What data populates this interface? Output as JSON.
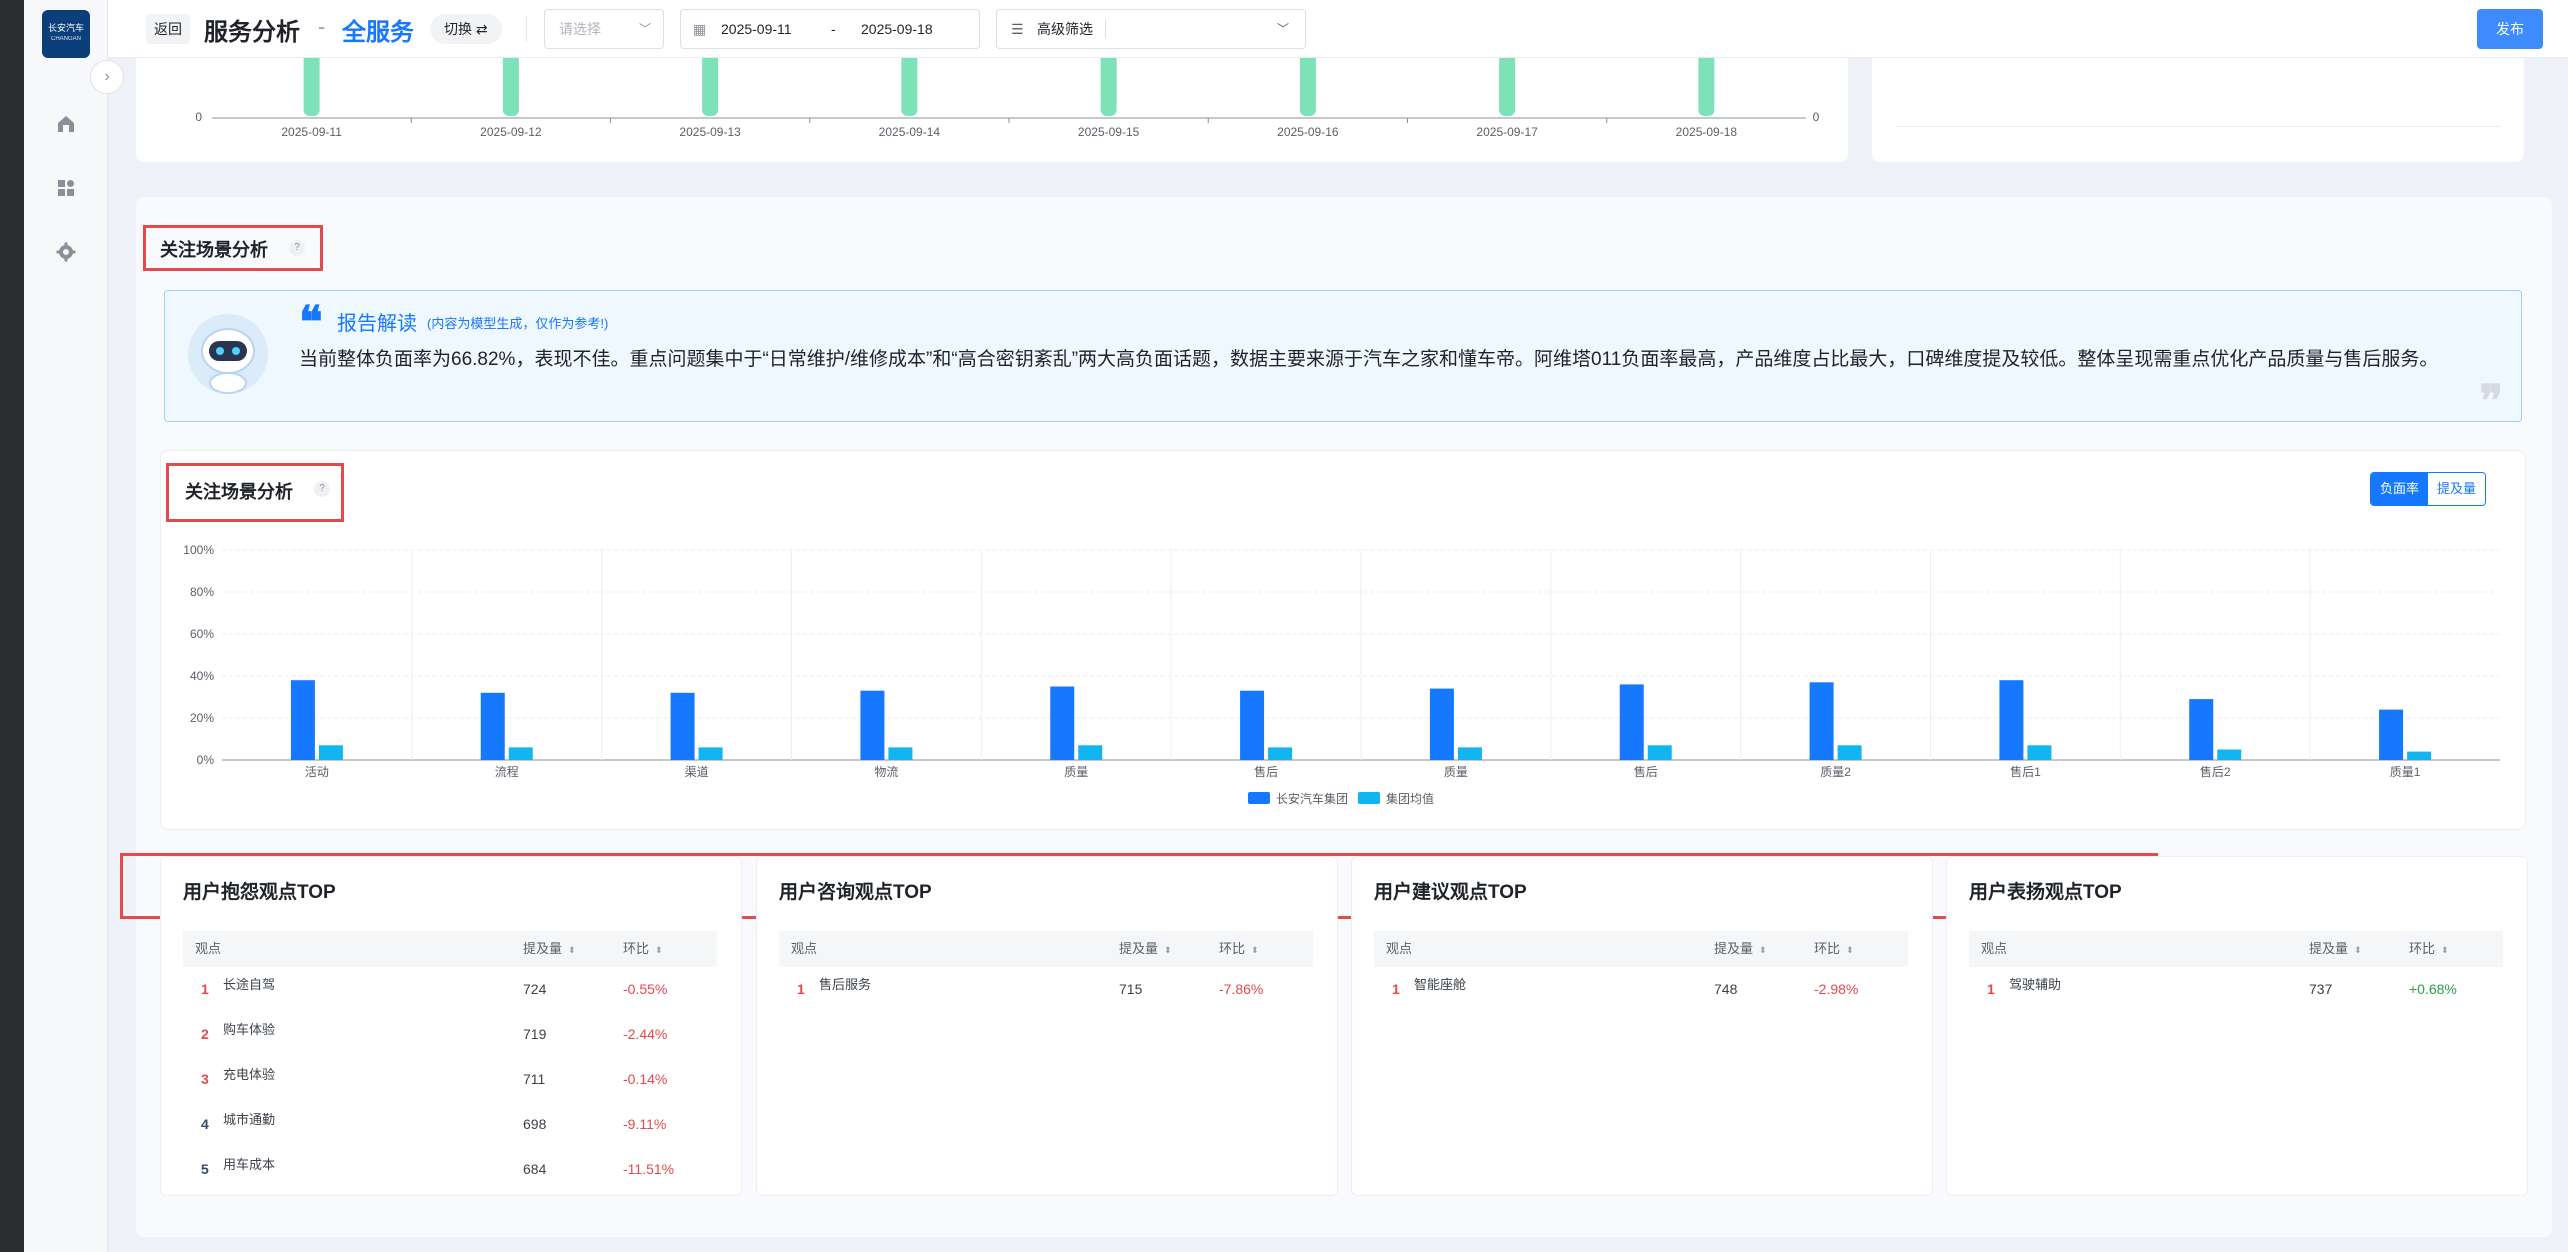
{
  "app": {
    "logo_text": "长安汽车",
    "logo_sub": "CHANGAN"
  },
  "header": {
    "back_label": "返回",
    "title": "服务分析",
    "separator": "-",
    "subtitle": "全服务",
    "switch_label": "切换 ⇄",
    "select_placeholder": "请选择",
    "date_start": "2025-09-11",
    "date_dash": "-",
    "date_end": "2025-09-18",
    "filter_label": "高级筛选",
    "publish_label": "发布"
  },
  "top_chart": {
    "zero_left": "0",
    "zero_right": "0",
    "dates": [
      "2025-09-11",
      "2025-09-12",
      "2025-09-13",
      "2025-09-14",
      "2025-09-15",
      "2025-09-16",
      "2025-09-17",
      "2025-09-18"
    ],
    "bar_color": "#7ee2b8"
  },
  "section": {
    "title": "关注场景分析",
    "help": "?"
  },
  "report": {
    "heading": "报告解读",
    "note": "(内容为模型生成，仅作为参考!)",
    "body": "当前整体负面率为66.82%，表现不佳。重点问题集中于“日常维护/维修成本”和“高合密钥紊乱”两大高负面话题，数据主要来源于汽车之家和懂车帝。阿维塔011负面率最高，产品维度占比最大，口碑维度提及较低。整体呈现需重点优化产品质量与售后服务。"
  },
  "scene_chart": {
    "title": "关注场景分析",
    "help": "?",
    "toggle": [
      "负面率",
      "提及量"
    ],
    "toggle_active": "负面率"
  },
  "chart_data": {
    "type": "bar",
    "title": "关注场景分析",
    "categories": [
      "活动",
      "流程",
      "渠道",
      "物流",
      "质量",
      "售后",
      "质量",
      "售后",
      "质量2",
      "售后1",
      "售后2",
      "质量1"
    ],
    "series": [
      {
        "name": "长安汽车集团",
        "color": "#1677ff",
        "values": [
          38,
          32,
          32,
          33,
          35,
          33,
          34,
          36,
          37,
          38,
          29,
          24
        ]
      },
      {
        "name": "集团均值",
        "color": "#13b5f0",
        "values": [
          7,
          6,
          6,
          6,
          7,
          6,
          6,
          7,
          7,
          7,
          5,
          4
        ]
      }
    ],
    "y_ticks": [
      "0%",
      "20%",
      "40%",
      "60%",
      "80%",
      "100%"
    ],
    "ylim": [
      0,
      100
    ],
    "grid": true,
    "legend": "bottom-center"
  },
  "tables": [
    {
      "title": "用户抱怨观点TOP",
      "headers": [
        "观点",
        "提及量",
        "环比"
      ],
      "rows": [
        {
          "rank": "1",
          "name": "长途自驾",
          "count": "724",
          "change": "-0.55%",
          "trend": "neg"
        },
        {
          "rank": "2",
          "name": "购车体验",
          "count": "719",
          "change": "-2.44%",
          "trend": "neg"
        },
        {
          "rank": "3",
          "name": "充电体验",
          "count": "711",
          "change": "-0.14%",
          "trend": "neg"
        },
        {
          "rank": "4",
          "name": "城市通勤",
          "count": "698",
          "change": "-9.11%",
          "trend": "neg"
        },
        {
          "rank": "5",
          "name": "用车成本",
          "count": "684",
          "change": "-11.51%",
          "trend": "neg"
        }
      ]
    },
    {
      "title": "用户咨询观点TOP",
      "headers": [
        "观点",
        "提及量",
        "环比"
      ],
      "rows": [
        {
          "rank": "1",
          "name": "售后服务",
          "count": "715",
          "change": "-7.86%",
          "trend": "neg"
        }
      ]
    },
    {
      "title": "用户建议观点TOP",
      "headers": [
        "观点",
        "提及量",
        "环比"
      ],
      "rows": [
        {
          "rank": "1",
          "name": "智能座舱",
          "count": "748",
          "change": "-2.98%",
          "trend": "neg"
        }
      ]
    },
    {
      "title": "用户表扬观点TOP",
      "headers": [
        "观点",
        "提及量",
        "环比"
      ],
      "rows": [
        {
          "rank": "1",
          "name": "驾驶辅助",
          "count": "737",
          "change": "+0.68%",
          "trend": "pos"
        }
      ]
    }
  ],
  "colors": {
    "accent": "#1677ff",
    "negative": "#e5484d",
    "positive": "#2ba24c",
    "rank_top3": "#e5484d",
    "rank_rest": "#3a4a6b"
  }
}
